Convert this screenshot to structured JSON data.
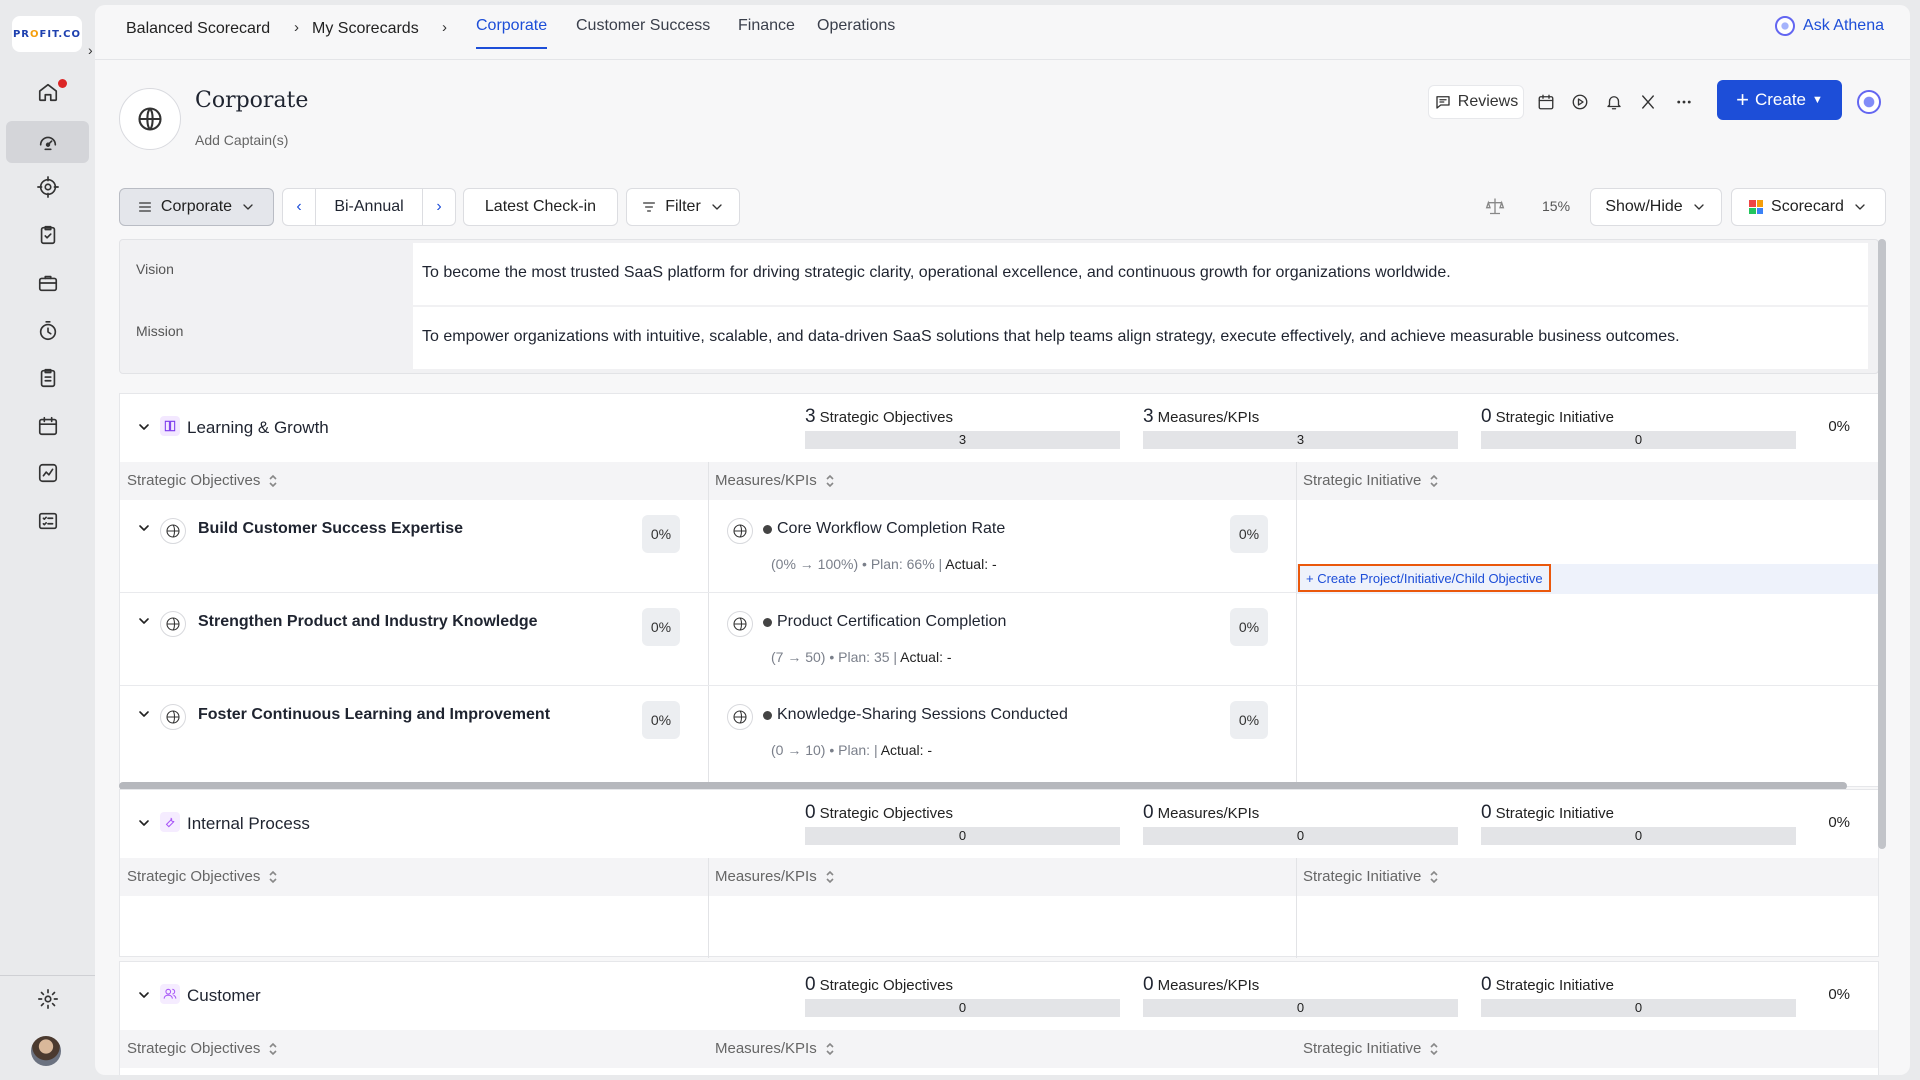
{
  "sidebar": {
    "logo": "PROFIT.CO",
    "items": [
      {
        "icon": "home-icon",
        "badge": true
      },
      {
        "icon": "dashboard-gauge-icon",
        "active": true
      },
      {
        "icon": "target-icon"
      },
      {
        "icon": "clipboard-check-icon"
      },
      {
        "icon": "briefcase-icon"
      },
      {
        "icon": "stopwatch-icon"
      },
      {
        "icon": "checklist-icon"
      },
      {
        "icon": "calendar-icon"
      },
      {
        "icon": "line-chart-icon"
      },
      {
        "icon": "task-list-icon"
      }
    ],
    "settings_icon": "gear-icon"
  },
  "topbar": {
    "breadcrumb": [
      "Balanced Scorecard",
      "My Scorecards"
    ],
    "tabs": [
      "Corporate",
      "Customer Success",
      "Finance",
      "Operations"
    ],
    "active_tab": "Corporate",
    "ask": "Ask Athena"
  },
  "header": {
    "title": "Corporate",
    "captains": "Add Captain(s)",
    "reviews": "Reviews",
    "create": "Create"
  },
  "toolbar": {
    "view": "Corporate",
    "period": "Bi-Annual",
    "checkin": "Latest Check-in",
    "filter": "Filter",
    "weight": "15%",
    "show_hide": "Show/Hide",
    "scorecard": "Scorecard"
  },
  "vision": {
    "label": "Vision",
    "text": "To become the most trusted SaaS platform for driving strategic clarity, operational excellence, and continuous growth for organizations worldwide."
  },
  "mission": {
    "label": "Mission",
    "text": "To empower organizations with intuitive, scalable, and data-driven SaaS solutions that help teams align strategy, execute effectively, and achieve measurable business outcomes."
  },
  "columns": {
    "objectives": "Strategic Objectives",
    "kpis": "Measures/KPIs",
    "initiatives": "Strategic Initiative"
  },
  "perspectives": [
    {
      "name": "Learning & Growth",
      "icon": "book-icon",
      "color": "#7c3aed",
      "objectives_count": "3",
      "objectives_label": "Strategic Objectives",
      "objectives_bar": "3",
      "kpis_count": "3",
      "kpis_label": "Measures/KPIs",
      "kpis_bar": "3",
      "initiatives_count": "0",
      "initiatives_label": "Strategic Initiative",
      "initiatives_bar": "0",
      "percent": "0%",
      "rows": [
        {
          "objective": "Build Customer Success Expertise",
          "obj_pct": "0%",
          "kpi": "Core Workflow Completion Rate",
          "kpi_pct": "0%",
          "range": "(0% → 100%) • Plan: 66% | ",
          "actual": "Actual: -"
        },
        {
          "objective": "Strengthen Product and Industry Knowledge",
          "obj_pct": "0%",
          "kpi": "Product Certification Completion",
          "kpi_pct": "0%",
          "range": "(7 → 50) • Plan: 35 | ",
          "actual": "Actual: -"
        },
        {
          "objective": "Foster Continuous Learning and Improvement",
          "obj_pct": "0%",
          "kpi": "Knowledge-Sharing Sessions Conducted",
          "kpi_pct": "0%",
          "range": "(0 → 10) • Plan:  | ",
          "actual": "Actual: -"
        }
      ],
      "create_link": "+ Create Project/Initiative/Child Objective"
    },
    {
      "name": "Internal Process",
      "icon": "wrench-icon",
      "color": "#a855f7",
      "objectives_count": "0",
      "objectives_label": "Strategic Objectives",
      "objectives_bar": "0",
      "kpis_count": "0",
      "kpis_label": "Measures/KPIs",
      "kpis_bar": "0",
      "initiatives_count": "0",
      "initiatives_label": "Strategic Initiative",
      "initiatives_bar": "0",
      "percent": "0%"
    },
    {
      "name": "Customer",
      "icon": "users-icon",
      "color": "#a855f7",
      "objectives_count": "0",
      "objectives_label": "Strategic Objectives",
      "objectives_bar": "0",
      "kpis_count": "0",
      "kpis_label": "Measures/KPIs",
      "kpis_bar": "0",
      "initiatives_count": "0",
      "initiatives_label": "Strategic Initiative",
      "initiatives_bar": "0",
      "percent": "0%"
    }
  ]
}
